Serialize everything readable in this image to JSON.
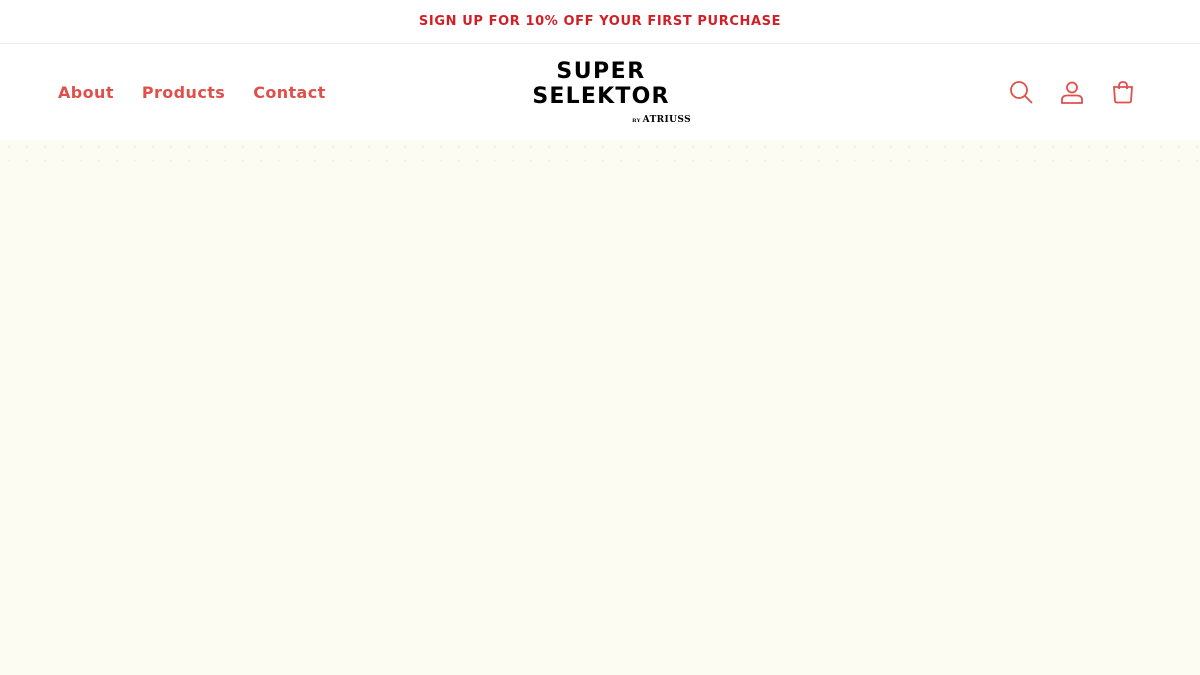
{
  "announcement": {
    "text": "SIGN UP FOR 10% OFF YOUR FIRST PURCHASE"
  },
  "nav": {
    "items": [
      {
        "label": "About"
      },
      {
        "label": "Products"
      },
      {
        "label": "Contact"
      }
    ]
  },
  "logo": {
    "line1": "SUPER",
    "line2": "SELEKTOR",
    "by": "BY",
    "brand": "ATRIUSS"
  },
  "icons": {
    "search": "search-icon",
    "account": "account-icon",
    "cart": "cart-icon"
  },
  "colors": {
    "announcement": "#d21f26",
    "accent": "#e0504a",
    "hero_background": "#fcfcf3"
  }
}
